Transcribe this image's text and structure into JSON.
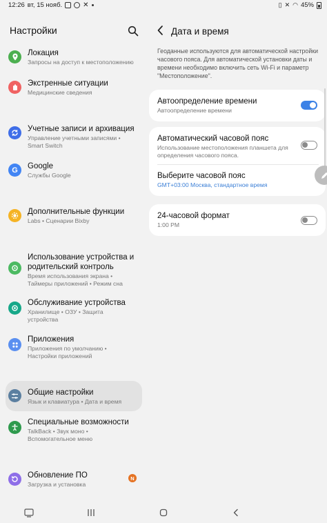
{
  "status_bar": {
    "time": "12:26",
    "date": "вт, 15 нояб.",
    "battery": "45%"
  },
  "left_panel": {
    "title": "Настройки",
    "items": [
      {
        "title": "Локация",
        "sub": "Запросы на доступ к местоположению",
        "icon": "location-icon",
        "color": "#4caf50"
      },
      {
        "title": "Экстренные ситуации",
        "sub": "Медицинские сведения",
        "icon": "emergency-icon",
        "color": "#f06262"
      },
      {
        "title": "Учетные записи и архивация",
        "sub1": "Управление учетными записями  •",
        "sub2": "Smart Switch",
        "icon": "sync-icon",
        "color": "#3f6ee8"
      },
      {
        "title": "Google",
        "sub": "Службы Google",
        "icon": "google-icon",
        "color": "#4285f4"
      },
      {
        "title": "Дополнительные функции",
        "sub": "Labs  •  Сценарии Bixby",
        "icon": "star-icon",
        "color": "#f5b324"
      },
      {
        "title1": "Использование устройства и",
        "title2": "родительский контроль",
        "sub1": "Время использования экрана  •",
        "sub2": "Таймеры приложений  •  Режим сна",
        "icon": "wellbeing-icon",
        "color": "#4cba62"
      },
      {
        "title": "Обслуживание устройства",
        "sub1": "Хранилище  •  ОЗУ  •  Защита",
        "sub2": "устройства",
        "icon": "care-icon",
        "color": "#17a889"
      },
      {
        "title": "Приложения",
        "sub1": "Приложения по умолчанию  •",
        "sub2": "Настройки приложений",
        "icon": "apps-icon",
        "color": "#5a8ff0"
      },
      {
        "title": "Общие настройки",
        "sub": "Язык и клавиатура  •  Дата и время",
        "icon": "sliders-icon",
        "color": "#5b7fa0"
      },
      {
        "title": "Специальные возможности",
        "sub1": "TalkBack  •  Звук моно  •",
        "sub2": "Вспомогательное меню",
        "icon": "accessibility-icon",
        "color": "#2e9a4d"
      },
      {
        "title": "Обновление ПО",
        "sub": "Загрузка и установка",
        "icon": "update-icon",
        "color": "#8e6ee8",
        "badge": "N"
      }
    ]
  },
  "right_panel": {
    "title": "Дата и время",
    "description": "Геоданные используются для автоматической настройки часового пояса. Для автоматической установки даты и времени необходимо включить сеть Wi-Fi и параметр \"Местоположение\".",
    "auto_time": {
      "title": "Автоопределение времени",
      "sub": "Автоопределение времени",
      "enabled": true
    },
    "auto_timezone": {
      "title": "Автоматический часовой пояс",
      "sub": "Использование местоположения планшета для определения часового пояса.",
      "enabled": false
    },
    "timezone": {
      "title": "Выберите часовой пояс",
      "value": "GMT+03:00 Москва, стандартное время"
    },
    "format_24h": {
      "title": "24-часовой формат",
      "sub": "1:00 PM",
      "enabled": false
    }
  },
  "colors": {
    "accent": "#3c82e6",
    "background": "#f2f2f2",
    "card": "#ffffff"
  }
}
